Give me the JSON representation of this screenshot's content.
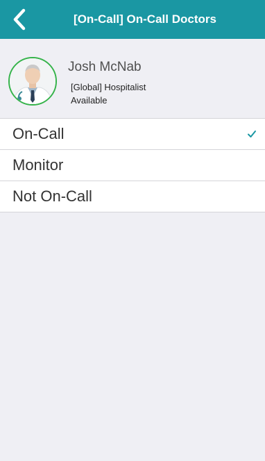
{
  "header": {
    "title": "[On-Call] On-Call Doctors",
    "back_icon": "chevron-left-icon",
    "background": "#1a97a3"
  },
  "profile": {
    "name": "Josh McNab",
    "role": "[Global] Hospitalist",
    "status": "Available",
    "avatar_ring_color": "#35b34a"
  },
  "options": [
    {
      "label": "On-Call",
      "selected": true
    },
    {
      "label": "Monitor",
      "selected": false
    },
    {
      "label": "Not On-Call",
      "selected": false
    }
  ],
  "accent": "#1a97a3"
}
